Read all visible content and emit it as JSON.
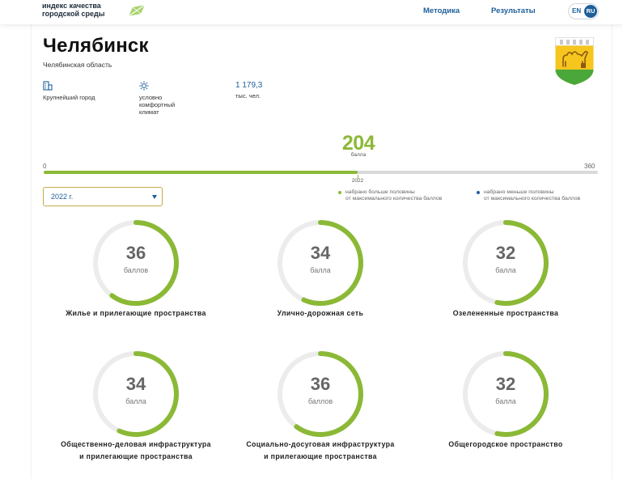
{
  "header": {
    "logo_line1": "индекс качества",
    "logo_line2": "городской среды",
    "nav": [
      {
        "label": "Методика"
      },
      {
        "label": "Результаты"
      }
    ],
    "lang": {
      "en": "EN",
      "ru": "RU",
      "active": "RU"
    }
  },
  "city": {
    "name": "Челябинск",
    "region": "Челябинская область",
    "crest_icon": "camel-crest-icon"
  },
  "facts": [
    {
      "icon": "building-icon",
      "text": "Крупнейший город"
    },
    {
      "icon": "sun-icon",
      "text": "условно\nкомфортный\nклимат"
    },
    {
      "value": "1 179,3",
      "text": "тыс. чел."
    }
  ],
  "total": {
    "score": "204",
    "unit": "балла",
    "min": "0",
    "max": "360",
    "score_value": 204,
    "max_value": 360,
    "year_label": "2022"
  },
  "year_select": {
    "value": "2022 г."
  },
  "legend": [
    {
      "color": "#8bb936",
      "text": "набрано больше половины\nот максимального количества баллов"
    },
    {
      "color": "#1e5f9a",
      "text": "набрано меньше половины\nот максимального количества баллов"
    }
  ],
  "categories": [
    {
      "value": "36",
      "unit": "баллов",
      "title": "Жилье и прилегающие пространства",
      "score": 36,
      "max": 60
    },
    {
      "value": "34",
      "unit": "балла",
      "title": "Улично-дорожная сеть",
      "score": 34,
      "max": 60
    },
    {
      "value": "32",
      "unit": "балла",
      "title": "Озелененные пространства",
      "score": 32,
      "max": 60
    },
    {
      "value": "34",
      "unit": "балла",
      "title": "Общественно-деловая инфраструктура\nи прилегающие пространства",
      "score": 34,
      "max": 60
    },
    {
      "value": "36",
      "unit": "баллов",
      "title": "Социально-досуговая инфраструктура\nи прилегающие пространства",
      "score": 36,
      "max": 60
    },
    {
      "value": "32",
      "unit": "балла",
      "title": "Общегородское пространство",
      "score": 32,
      "max": 60
    }
  ],
  "colors": {
    "accent": "#8bb936",
    "primary": "#1e5f9a",
    "ring_track": "#ececec"
  }
}
